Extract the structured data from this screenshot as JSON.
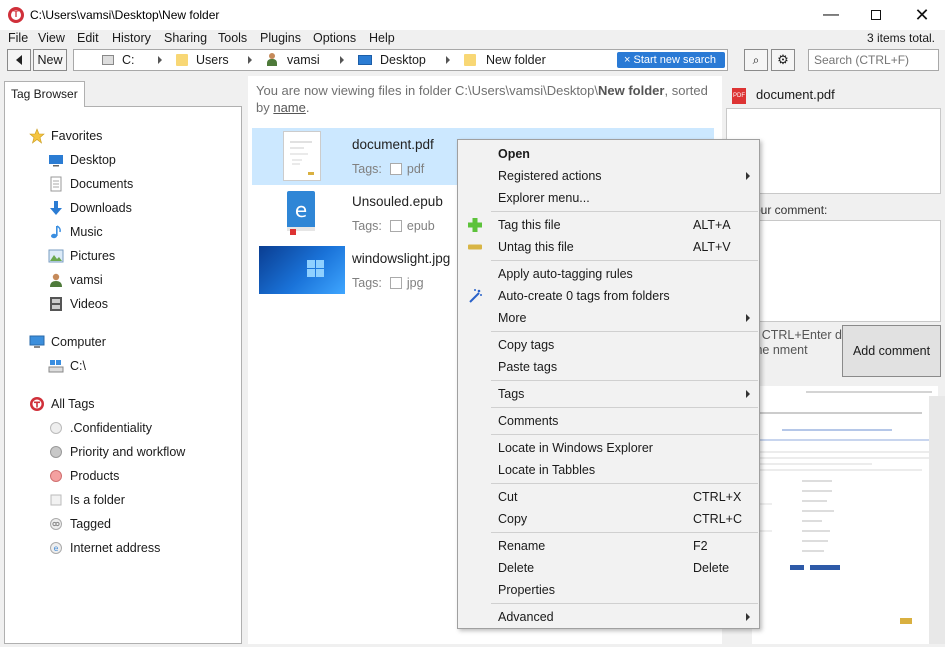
{
  "window": {
    "title": "C:\\Users\\vamsi\\Desktop\\New folder",
    "app_icon_letter": "T",
    "minimize": "—",
    "close": "✕"
  },
  "menubar": {
    "items": [
      "File",
      "View",
      "Edit",
      "History",
      "Sharing",
      "Tools",
      "Plugins",
      "Options",
      "Help"
    ],
    "items_total": "3 items total."
  },
  "toolbar": {
    "new_label": "New",
    "breadcrumbs": [
      "C:",
      "Users",
      "vamsi",
      "Desktop",
      "New folder"
    ],
    "start_search_label": "Start new search",
    "start_search_x": "×",
    "search_placeholder": "Search (CTRL+F)",
    "find_glyph": "⌕",
    "settings_glyph": "⚙"
  },
  "left_panel": {
    "tab_label": "Tag Browser",
    "tree": [
      {
        "label": "Favorites",
        "icon": "star-icon"
      },
      {
        "label": "Desktop",
        "icon": "desktop-icon"
      },
      {
        "label": "Documents",
        "icon": "documents-icon"
      },
      {
        "label": "Downloads",
        "icon": "downloads-icon"
      },
      {
        "label": "Music",
        "icon": "music-icon"
      },
      {
        "label": "Pictures",
        "icon": "pictures-icon"
      },
      {
        "label": "vamsi",
        "icon": "user-icon"
      },
      {
        "label": "Videos",
        "icon": "videos-icon"
      },
      {
        "label": "Computer",
        "icon": "computer-icon"
      },
      {
        "label": "C:\\",
        "icon": "drive-icon"
      },
      {
        "label": "All Tags",
        "icon": "tabbles-icon"
      },
      {
        "label": ".Confidentiality",
        "icon": "tag-icon"
      },
      {
        "label": "Priority and workflow",
        "icon": "tag-icon"
      },
      {
        "label": "Products",
        "icon": "tag-icon"
      },
      {
        "label": "Is a folder",
        "icon": "tag-icon"
      },
      {
        "label": "Tagged",
        "icon": "tag-icon"
      },
      {
        "label": "Internet address",
        "icon": "tag-icon"
      }
    ]
  },
  "center": {
    "info_prefix": "You are now viewing files in folder ",
    "info_path": "C:\\Users\\vamsi\\Desktop\\",
    "info_folder": "New folder",
    "info_sorted": ", sorted by ",
    "info_sort_key": "name",
    "info_period": ".",
    "files": [
      {
        "name": "document.pdf",
        "tags_label": "Tags:",
        "tag": "pdf"
      },
      {
        "name": "Unsouled.epub",
        "tags_label": "Tags:",
        "tag": "epub"
      },
      {
        "name": "windowslight.jpg",
        "tags_label": "Tags:",
        "tag": "jpg"
      }
    ]
  },
  "right_panel": {
    "filename": "document.pdf",
    "pdf_badge": "PDF",
    "comment_label": "our comment:",
    "comment_hint": "s CTRL+Enter dd the nment",
    "add_comment_label": "Add comment"
  },
  "context_menu": {
    "open": "Open",
    "registered_actions": "Registered actions",
    "explorer_menu": "Explorer menu...",
    "tag_file": "Tag this file",
    "tag_file_short": "ALT+A",
    "untag_file": "Untag this file",
    "untag_file_short": "ALT+V",
    "auto_tagging": "Apply auto-tagging rules",
    "auto_create": "Auto-create 0 tags from folders",
    "more": "More",
    "copy_tags": "Copy tags",
    "paste_tags": "Paste tags",
    "tags": "Tags",
    "comments": "Comments",
    "locate_explorer": "Locate in Windows Explorer",
    "locate_tabbles": "Locate in Tabbles",
    "cut": "Cut",
    "cut_short": "CTRL+X",
    "copy": "Copy",
    "copy_short": "CTRL+C",
    "rename": "Rename",
    "rename_short": "F2",
    "delete": "Delete",
    "delete_short": "Delete",
    "properties": "Properties",
    "advanced": "Advanced"
  },
  "colors": {
    "accent": "#2a7ad5",
    "selection": "#cce8ff",
    "tabbles_red": "#d0303a"
  }
}
